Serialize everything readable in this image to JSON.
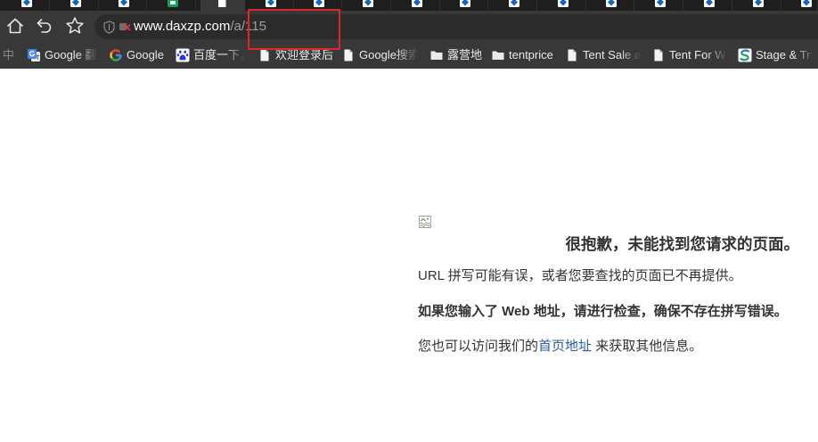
{
  "browser": {
    "tabs": [
      {
        "icon": "site-logo-icon"
      },
      {
        "icon": "site-logo-icon"
      },
      {
        "icon": "site-logo-icon"
      },
      {
        "icon": "green-app-icon"
      },
      {
        "icon": "blank-page-icon",
        "active": true
      },
      {
        "icon": "site-logo-icon"
      },
      {
        "icon": "site-logo-icon"
      },
      {
        "icon": "site-logo-icon"
      },
      {
        "icon": "site-logo-icon"
      },
      {
        "icon": "site-logo-icon"
      },
      {
        "icon": "site-logo-icon"
      },
      {
        "icon": "site-logo-icon"
      },
      {
        "icon": "site-logo-icon"
      },
      {
        "icon": "site-logo-icon"
      },
      {
        "icon": "site-logo-icon"
      },
      {
        "icon": "site-logo-icon"
      },
      {
        "icon": "site-logo-icon"
      }
    ],
    "toolbar": {
      "home_icon": "home-icon",
      "back_icon": "back-arrow-icon",
      "bookmark_icon": "star-icon"
    },
    "address": {
      "security_icon": "shield-icon",
      "status_icon": "not-secure-icon",
      "domain": "www.daxzp.com",
      "path": "/a/115"
    },
    "bookmarks_lead": "中",
    "bookmarks": [
      {
        "icon": "google-translate-icon",
        "label": "Google 翻"
      },
      {
        "icon": "google-icon",
        "label": "Google"
      },
      {
        "icon": "baidu-paw-icon",
        "label": "百度一下，"
      },
      {
        "icon": "bookmark-page-icon",
        "label": "欢迎登录后"
      },
      {
        "icon": "bookmark-page-icon",
        "label": "Google搜索"
      },
      {
        "icon": "folder-icon",
        "label": "露营地"
      },
      {
        "icon": "folder-icon",
        "label": "tentprice"
      },
      {
        "icon": "bookmark-page-icon",
        "label": "Tent Sale a"
      },
      {
        "icon": "bookmark-page-icon",
        "label": "Tent For W"
      },
      {
        "icon": "stage-logo-icon",
        "label": "Stage & Tr"
      }
    ]
  },
  "page": {
    "image_icon": "broken-image-icon",
    "heading": "很抱歉，未能找到您请求的页面。",
    "line1": "URL 拼写可能有误，或者您要查找的页面已不再提供。",
    "line2": "如果您输入了 Web 地址，请进行检查，确保不存在拼写错误。",
    "line3_before": "您也可以访问我们的",
    "line3_link": "首页地址",
    "line3_after": " 来获取其他信息。"
  },
  "colors": {
    "tabstrip_bg": "#1e1e1e",
    "toolbar_bg": "#383838",
    "address_bg": "#2b2b2b",
    "annotation": "#e0262a",
    "link": "#2a5ca8",
    "text": "#333333"
  }
}
